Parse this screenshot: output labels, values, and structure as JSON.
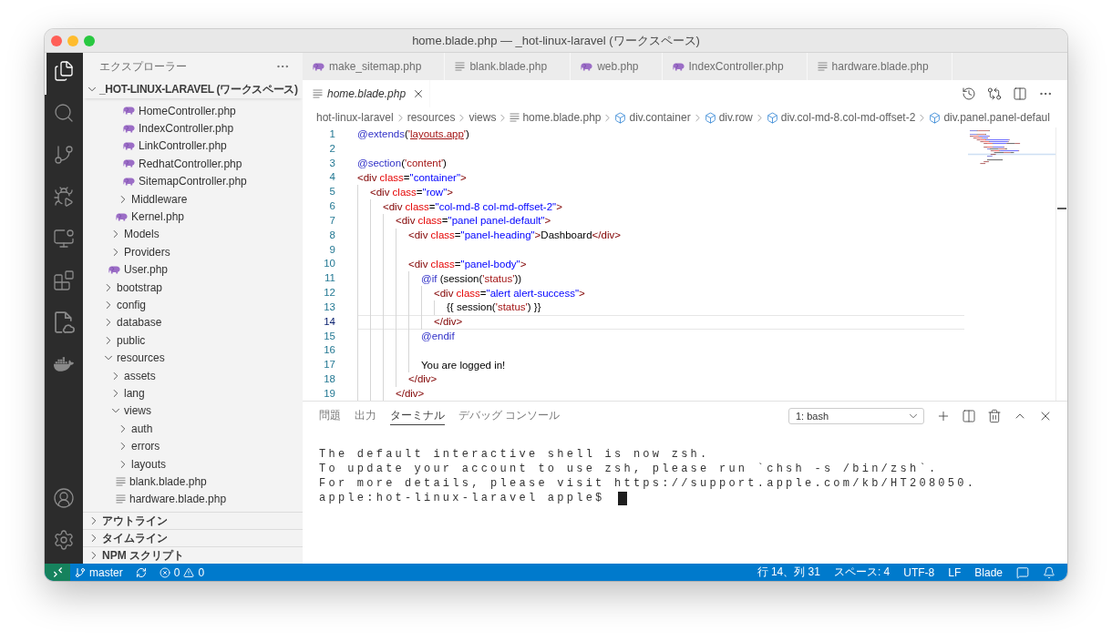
{
  "window": {
    "title": "home.blade.php — _hot-linux-laravel (ワークスペース)"
  },
  "activity_bar": {
    "items": [
      {
        "kind": "explorer",
        "selected": true
      },
      {
        "kind": "search",
        "selected": false
      },
      {
        "kind": "scm",
        "selected": false
      },
      {
        "kind": "debug",
        "selected": false
      },
      {
        "kind": "remote",
        "selected": false
      },
      {
        "kind": "extensions",
        "selected": false
      },
      {
        "kind": "cloudfile",
        "selected": false
      },
      {
        "kind": "docker",
        "selected": false
      }
    ]
  },
  "sidebar": {
    "title": "エクスプローラー",
    "workspace": {
      "label": "_HOT-LINUX-LARAVEL (ワークスペース)",
      "expanded": true
    },
    "tree": [
      {
        "children": [
          {
            "children": [
              {
                "children": [
                  {
                    "kind": "php",
                    "label": "HomeController.php"
                  },
                  {
                    "kind": "php",
                    "label": "IndexController.php"
                  },
                  {
                    "kind": "php",
                    "label": "LinkController.php"
                  },
                  {
                    "kind": "php",
                    "label": "RedhatController.php"
                  },
                  {
                    "kind": "php",
                    "label": "SitemapController.php"
                  }
                ]
              },
              {
                "kind": "folder",
                "label": "Middleware",
                "expanded": false
              },
              {
                "kind": "php",
                "label": "Kernel.php"
              }
            ]
          },
          {
            "kind": "folder",
            "label": "Models",
            "expanded": false
          },
          {
            "kind": "folder",
            "label": "Providers",
            "expanded": false
          },
          {
            "kind": "php",
            "label": "User.php"
          }
        ]
      },
      {
        "kind": "folder",
        "label": "bootstrap",
        "expanded": false
      },
      {
        "kind": "folder",
        "label": "config",
        "expanded": false
      },
      {
        "kind": "folder",
        "label": "database",
        "expanded": false
      },
      {
        "kind": "folder",
        "label": "public",
        "expanded": false
      },
      {
        "kind": "folder",
        "label": "resources",
        "expanded": true,
        "children": [
          {
            "kind": "folder",
            "label": "assets",
            "expanded": false
          },
          {
            "kind": "folder",
            "label": "lang",
            "expanded": false
          },
          {
            "kind": "folder",
            "label": "views",
            "expanded": true,
            "children": [
              {
                "kind": "folder",
                "label": "auth",
                "expanded": false
              },
              {
                "kind": "folder",
                "label": "errors",
                "expanded": false
              },
              {
                "kind": "folder",
                "label": "layouts",
                "expanded": false
              },
              {
                "kind": "plain",
                "label": "blank.blade.php"
              },
              {
                "kind": "plain",
                "label": "hardware.blade.php"
              }
            ]
          }
        ]
      }
    ],
    "sections": [
      {
        "label": "アウトライン",
        "expanded": false
      },
      {
        "label": "タイムライン",
        "expanded": false
      },
      {
        "label": "NPM スクリプト",
        "expanded": false
      }
    ]
  },
  "editor": {
    "tab_rows": [
      {
        "tabs": [
          {
            "label": "make_sitemap.php",
            "kind": "php",
            "selected": false,
            "preview": false
          },
          {
            "label": "blank.blade.php",
            "kind": "plain",
            "selected": false,
            "preview": false
          },
          {
            "label": "web.php",
            "kind": "php",
            "selected": false,
            "preview": false
          },
          {
            "label": "IndexController.php",
            "kind": "php",
            "selected": false,
            "preview": false
          },
          {
            "label": "hardware.blade.php",
            "kind": "plain",
            "selected": false,
            "preview": false
          }
        ]
      },
      {
        "tabs": [
          {
            "label": "home.blade.php",
            "kind": "plain",
            "selected": true,
            "preview": true
          }
        ]
      }
    ],
    "breadcrumbs": [
      {
        "label": "hot-linux-laravel",
        "kind": "folder"
      },
      {
        "label": "resources",
        "kind": "folder"
      },
      {
        "label": "views",
        "kind": "folder"
      },
      {
        "label": "home.blade.php",
        "kind": "file"
      },
      {
        "label": "div.container",
        "kind": "element"
      },
      {
        "label": "div.row",
        "kind": "element"
      },
      {
        "label": "div.col-md-8.col-md-offset-2",
        "kind": "element"
      },
      {
        "label": "div.panel.panel-defaul",
        "kind": "element"
      }
    ],
    "code": {
      "lines": [
        {
          "number": "1",
          "current": false,
          "tokens": [
            {
              "text": "@extends",
              "kind": "directive"
            },
            {
              "text": "(",
              "kind": "plain"
            },
            {
              "text": "'",
              "kind": "string"
            },
            {
              "text": "layouts.app",
              "kind": "link"
            },
            {
              "text": "'",
              "kind": "string"
            },
            {
              "text": ")",
              "kind": "plain"
            }
          ]
        },
        {
          "number": "2",
          "current": false
        },
        {
          "number": "3",
          "current": false,
          "tokens": [
            {
              "text": "@section",
              "kind": "directive"
            },
            {
              "text": "(",
              "kind": "plain"
            },
            {
              "text": "'content'",
              "kind": "string"
            },
            {
              "text": ")",
              "kind": "plain"
            }
          ]
        },
        {
          "number": "4",
          "current": false,
          "tokens": [
            {
              "text": "<div",
              "kind": "tag"
            },
            {
              "text": " class",
              "kind": "attr"
            },
            {
              "text": "=",
              "kind": "plain"
            },
            {
              "text": "\"container\"",
              "kind": "value"
            },
            {
              "text": ">",
              "kind": "tag"
            }
          ],
          "children": [
            {
              "number": "5",
              "current": false,
              "tokens": [
                {
                  "text": "<div",
                  "kind": "tag"
                },
                {
                  "text": " class",
                  "kind": "attr"
                },
                {
                  "text": "=",
                  "kind": "plain"
                },
                {
                  "text": "\"row\"",
                  "kind": "value"
                },
                {
                  "text": ">",
                  "kind": "tag"
                }
              ],
              "children": [
                {
                  "number": "6",
                  "current": false,
                  "tokens": [
                    {
                      "text": "<div",
                      "kind": "tag"
                    },
                    {
                      "text": " class",
                      "kind": "attr"
                    },
                    {
                      "text": "=",
                      "kind": "plain"
                    },
                    {
                      "text": "\"col-md-8 col-md-offset-2\"",
                      "kind": "value"
                    },
                    {
                      "text": ">",
                      "kind": "tag"
                    }
                  ],
                  "children": [
                    {
                      "number": "7",
                      "current": false,
                      "tokens": [
                        {
                          "text": "<div",
                          "kind": "tag"
                        },
                        {
                          "text": " class",
                          "kind": "attr"
                        },
                        {
                          "text": "=",
                          "kind": "plain"
                        },
                        {
                          "text": "\"panel panel-default\"",
                          "kind": "value"
                        },
                        {
                          "text": ">",
                          "kind": "tag"
                        }
                      ],
                      "children": [
                        {
                          "number": "8",
                          "current": false,
                          "tokens": [
                            {
                              "text": "<div",
                              "kind": "tag"
                            },
                            {
                              "text": " class",
                              "kind": "attr"
                            },
                            {
                              "text": "=",
                              "kind": "plain"
                            },
                            {
                              "text": "\"panel-heading\"",
                              "kind": "value"
                            },
                            {
                              "text": ">",
                              "kind": "tag"
                            },
                            {
                              "text": "Dashboard",
                              "kind": "plain"
                            },
                            {
                              "text": "</div>",
                              "kind": "tag"
                            }
                          ]
                        },
                        {
                          "number": "9",
                          "current": false
                        },
                        {
                          "number": "10",
                          "current": false,
                          "tokens": [
                            {
                              "text": "<div",
                              "kind": "tag"
                            },
                            {
                              "text": " class",
                              "kind": "attr"
                            },
                            {
                              "text": "=",
                              "kind": "plain"
                            },
                            {
                              "text": "\"panel-body\"",
                              "kind": "value"
                            },
                            {
                              "text": ">",
                              "kind": "tag"
                            }
                          ],
                          "children": [
                            {
                              "number": "11",
                              "current": false,
                              "tokens": [
                                {
                                  "text": "@if",
                                  "kind": "directive"
                                },
                                {
                                  "text": " (session(",
                                  "kind": "plain"
                                },
                                {
                                  "text": "'status'",
                                  "kind": "string"
                                },
                                {
                                  "text": "))",
                                  "kind": "plain"
                                }
                              ],
                              "children": [
                                {
                                  "number": "12",
                                  "current": false,
                                  "tokens": [
                                    {
                                      "text": "<div",
                                      "kind": "tag"
                                    },
                                    {
                                      "text": " class",
                                      "kind": "attr"
                                    },
                                    {
                                      "text": "=",
                                      "kind": "plain"
                                    },
                                    {
                                      "text": "\"alert alert-success\"",
                                      "kind": "value"
                                    },
                                    {
                                      "text": ">",
                                      "kind": "tag"
                                    }
                                  ],
                                  "children": [
                                    {
                                      "number": "13",
                                      "current": false,
                                      "tokens": [
                                        {
                                          "text": "{{ session(",
                                          "kind": "plain"
                                        },
                                        {
                                          "text": "'status'",
                                          "kind": "string"
                                        },
                                        {
                                          "text": ") }}",
                                          "kind": "plain"
                                        }
                                      ]
                                    }
                                  ]
                                },
                                {
                                  "number": "14",
                                  "current": true,
                                  "tokens": [
                                    {
                                      "text": "</div>",
                                      "kind": "tag"
                                    }
                                  ]
                                }
                              ]
                            },
                            {
                              "number": "15",
                              "current": false,
                              "tokens": [
                                {
                                  "text": "@endif",
                                  "kind": "directive"
                                }
                              ]
                            },
                            {
                              "number": "16",
                              "current": false
                            },
                            {
                              "number": "17",
                              "current": false,
                              "tokens": [
                                {
                                  "text": "You are logged in!",
                                  "kind": "plain"
                                }
                              ]
                            }
                          ]
                        },
                        {
                          "number": "18",
                          "current": false,
                          "tokens": [
                            {
                              "text": "</div>",
                              "kind": "tag"
                            }
                          ]
                        }
                      ]
                    },
                    {
                      "number": "19",
                      "current": false,
                      "tokens": [
                        {
                          "text": "</div>",
                          "kind": "tag"
                        }
                      ]
                    }
                  ]
                }
              ]
            }
          ]
        }
      ]
    }
  },
  "panel": {
    "tabs": [
      {
        "label": "問題",
        "selected": false
      },
      {
        "label": "出力",
        "selected": false
      },
      {
        "label": "ターミナル",
        "selected": true
      },
      {
        "label": "デバッグ コンソール",
        "selected": false
      }
    ],
    "terminal_select": {
      "value": "1: bash"
    },
    "terminal": {
      "lines": [
        "The default interactive shell is now zsh.",
        "To update your account to use zsh, please run `chsh -s /bin/zsh`.",
        "For more details, please visit https://support.apple.com/kb/HT208050."
      ],
      "prompt": "apple:hot-linux-laravel apple$"
    }
  },
  "status_bar": {
    "branch": "master",
    "errors": "0",
    "warnings": "0",
    "items": [
      "行 14、列 31",
      "スペース: 4",
      "UTF-8",
      "LF",
      "Blade"
    ]
  }
}
